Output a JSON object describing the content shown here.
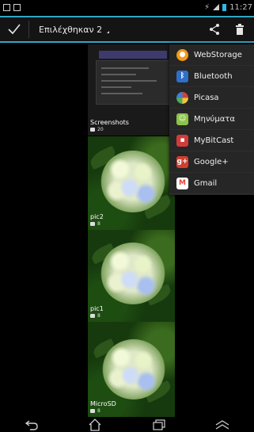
{
  "status_bar": {
    "time": "11:27"
  },
  "action_bar": {
    "title": "Επιλέχθηκαν 2"
  },
  "gallery": [
    {
      "id": "screenshots",
      "label": "Screenshots",
      "count": "20",
      "selected": false
    },
    {
      "id": "pic2",
      "label": "pic2",
      "count": "8",
      "selected": true
    },
    {
      "id": "pic1",
      "label": "pic1",
      "count": "8",
      "selected": true
    },
    {
      "id": "microsd",
      "label": "MicroSD",
      "count": "8",
      "selected": false
    }
  ],
  "share_menu": {
    "items": [
      {
        "label": "WebStorage",
        "icon": "webstorage-icon",
        "color": "#f39a1c"
      },
      {
        "label": "Bluetooth",
        "icon": "bluetooth-icon",
        "color": "#2f6fc8"
      },
      {
        "label": "Picasa",
        "icon": "picasa-icon",
        "color": "#c9443e"
      },
      {
        "label": "Μηνύματα",
        "icon": "messages-icon",
        "color": "#8bc34a"
      },
      {
        "label": "MyBitCast",
        "icon": "mybitcast-icon",
        "color": "#d23b3b"
      },
      {
        "label": "Google+",
        "icon": "google-plus-icon",
        "color": "#d13f2f"
      },
      {
        "label": "Gmail",
        "icon": "gmail-icon",
        "color": "#e44134"
      }
    ]
  },
  "nav_bar": {
    "buttons": [
      "back-icon",
      "home-icon",
      "recents-icon",
      "menu-icon"
    ]
  }
}
